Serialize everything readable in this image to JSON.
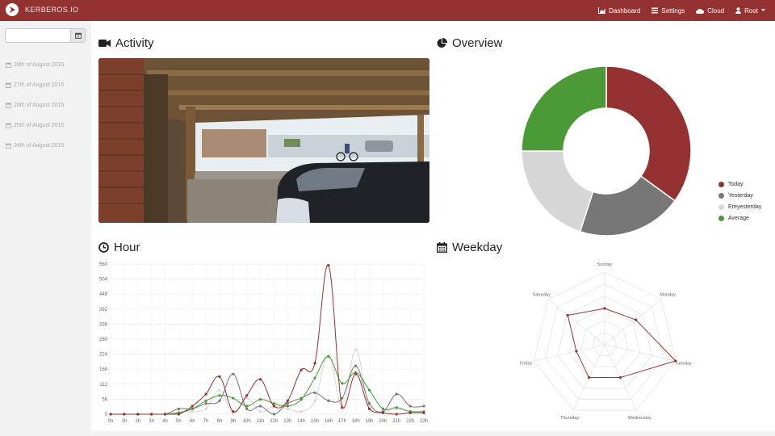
{
  "nav": {
    "brand": "KERBEROS.IO",
    "links": [
      {
        "label": "Dashboard",
        "icon": "chart-icon"
      },
      {
        "label": "Settings",
        "icon": "list-icon"
      },
      {
        "label": "Cloud",
        "icon": "cloud-icon"
      },
      {
        "label": "Root",
        "icon": "user-icon"
      }
    ]
  },
  "sidebar": {
    "date_input": {
      "value": "",
      "placeholder": ""
    },
    "days": [
      {
        "label": "28th of August 2015"
      },
      {
        "label": "27th of August 2015"
      },
      {
        "label": "26th of August 2015"
      },
      {
        "label": "25th of August 2015"
      },
      {
        "label": "24th of August 2015"
      }
    ]
  },
  "sections": {
    "activity": "Activity",
    "overview": "Overview",
    "hour": "Hour",
    "weekday": "Weekday"
  },
  "colors": {
    "today": "#943232",
    "yesterday": "#777777",
    "ereyesterday": "#d6d6d6",
    "average": "#4b9a37"
  },
  "chart_data": [
    {
      "type": "pie",
      "title": "Overview",
      "categories": [
        "Today",
        "Yesterday",
        "Ereyesterday",
        "Average"
      ],
      "values": [
        35,
        20,
        20,
        25
      ],
      "legend": "right",
      "donut": true
    },
    {
      "type": "line",
      "title": "Hour",
      "categories": [
        "0h",
        "1h",
        "2h",
        "3h",
        "4h",
        "5h",
        "6h",
        "7h",
        "8h",
        "9h",
        "10h",
        "11h",
        "12h",
        "13h",
        "14h",
        "15h",
        "16h",
        "17h",
        "18h",
        "19h",
        "20h",
        "21h",
        "22h",
        "23h"
      ],
      "ylim": [
        0,
        560
      ],
      "yticks": [
        "0",
        "56",
        "112",
        "168",
        "224",
        "280",
        "336",
        "392",
        "448",
        "504",
        "560"
      ],
      "grid": true,
      "series": [
        {
          "name": "Today",
          "values": [
            0,
            0,
            0,
            0,
            0,
            0,
            30,
            75,
            140,
            10,
            70,
            130,
            30,
            50,
            165,
            190,
            555,
            25,
            150,
            20,
            5,
            0,
            5,
            5
          ]
        },
        {
          "name": "Yesterday",
          "values": [
            0,
            0,
            0,
            0,
            0,
            20,
            20,
            40,
            50,
            150,
            20,
            30,
            0,
            40,
            60,
            80,
            50,
            60,
            180,
            40,
            10,
            75,
            30,
            30
          ]
        },
        {
          "name": "Ereyesterday",
          "values": [
            0,
            0,
            0,
            0,
            0,
            10,
            10,
            20,
            90,
            5,
            60,
            10,
            30,
            20,
            10,
            50,
            220,
            30,
            240,
            20,
            10,
            20,
            10,
            10
          ]
        },
        {
          "name": "Average",
          "values": [
            0,
            0,
            0,
            0,
            0,
            5,
            20,
            50,
            70,
            60,
            30,
            55,
            40,
            30,
            55,
            135,
            215,
            115,
            155,
            90,
            20,
            25,
            10,
            10
          ]
        }
      ]
    },
    {
      "type": "radar",
      "title": "Weekday",
      "categories": [
        "Sunday",
        "Monday",
        "Tuesday",
        "Wednesday",
        "Thursday",
        "Friday",
        "Saturday"
      ],
      "rmax": 100,
      "series": [
        {
          "name": "Today",
          "values": [
            50,
            55,
            100,
            50,
            50,
            40,
            65
          ]
        }
      ]
    }
  ]
}
